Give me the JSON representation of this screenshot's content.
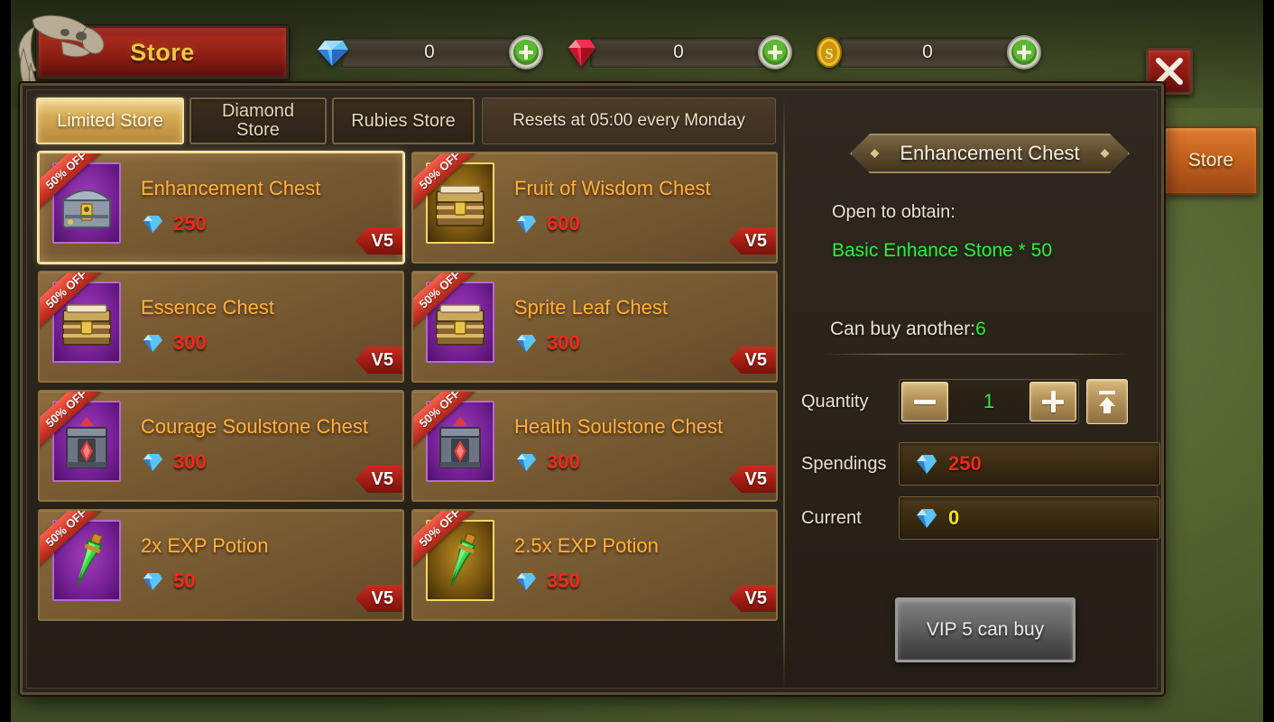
{
  "window": {
    "title": "Store",
    "close_label": "close-button"
  },
  "currencies": [
    {
      "icon": "diamond-icon",
      "value": "0",
      "add_label": "+"
    },
    {
      "icon": "ruby-icon",
      "value": "0",
      "add_label": "+"
    },
    {
      "icon": "gold-coin-icon",
      "value": "0",
      "add_label": "+"
    }
  ],
  "side_tab": {
    "label": "Store"
  },
  "tabs": [
    {
      "label": "Limited Store",
      "active": true
    },
    {
      "label": "Diamond Store",
      "active": false
    },
    {
      "label": "Rubies Store",
      "active": false
    }
  ],
  "reset_note": "Resets at 05:00 every Monday",
  "items": [
    {
      "name": "Enhancement Chest",
      "price": "250",
      "currency": "diamond-icon",
      "discount": "50% OFF",
      "vip": "V5",
      "rarity": "purple",
      "icon": "chest-steel-icon",
      "selected": true
    },
    {
      "name": "Fruit of Wisdom Chest",
      "price": "600",
      "currency": "diamond-icon",
      "discount": "50% OFF",
      "vip": "V5",
      "rarity": "gold",
      "icon": "chest-wood-icon",
      "selected": false
    },
    {
      "name": "Essence Chest",
      "price": "300",
      "currency": "diamond-icon",
      "discount": "50% OFF",
      "vip": "V5",
      "rarity": "purple",
      "icon": "chest-wood-icon",
      "selected": false
    },
    {
      "name": "Sprite Leaf Chest",
      "price": "300",
      "currency": "diamond-icon",
      "discount": "50% OFF",
      "vip": "V5",
      "rarity": "purple",
      "icon": "chest-wood-icon",
      "selected": false
    },
    {
      "name": "Courage Soulstone Chest",
      "price": "300",
      "currency": "diamond-icon",
      "discount": "50% OFF",
      "vip": "V5",
      "rarity": "purple",
      "icon": "chest-soulstone-icon",
      "selected": false
    },
    {
      "name": "Health Soulstone Chest",
      "price": "300",
      "currency": "diamond-icon",
      "discount": "50% OFF",
      "vip": "V5",
      "rarity": "purple",
      "icon": "chest-soulstone-icon",
      "selected": false
    },
    {
      "name": "2x EXP Potion",
      "price": "50",
      "currency": "diamond-icon",
      "discount": "50% OFF",
      "vip": "V5",
      "rarity": "purple",
      "icon": "potion-icon",
      "selected": false
    },
    {
      "name": "2.5x EXP Potion",
      "price": "350",
      "currency": "diamond-icon",
      "discount": "50% OFF",
      "vip": "V5",
      "rarity": "gold",
      "icon": "potion-icon",
      "selected": false
    }
  ],
  "detail": {
    "title": "Enhancement Chest",
    "obtain_label": "Open to obtain:",
    "obtain_value": "Basic Enhance Stone * 50",
    "can_buy_label": "Can buy another:",
    "can_buy_value": "6",
    "quantity_label": "Quantity",
    "quantity_value": "1",
    "decrease_label": "minus-button",
    "increase_label": "plus-button",
    "max_label": "max-button",
    "spendings_label": "Spendings",
    "spendings_value": "250",
    "current_label": "Current",
    "current_value": "0",
    "buy_button_label": "VIP 5 can buy"
  },
  "colors": {
    "accent_gold": "#ffb23c",
    "price_red": "#f4281c",
    "green": "#2ef037",
    "yellow": "#f2e419",
    "brand_red": "#a52a1c"
  }
}
